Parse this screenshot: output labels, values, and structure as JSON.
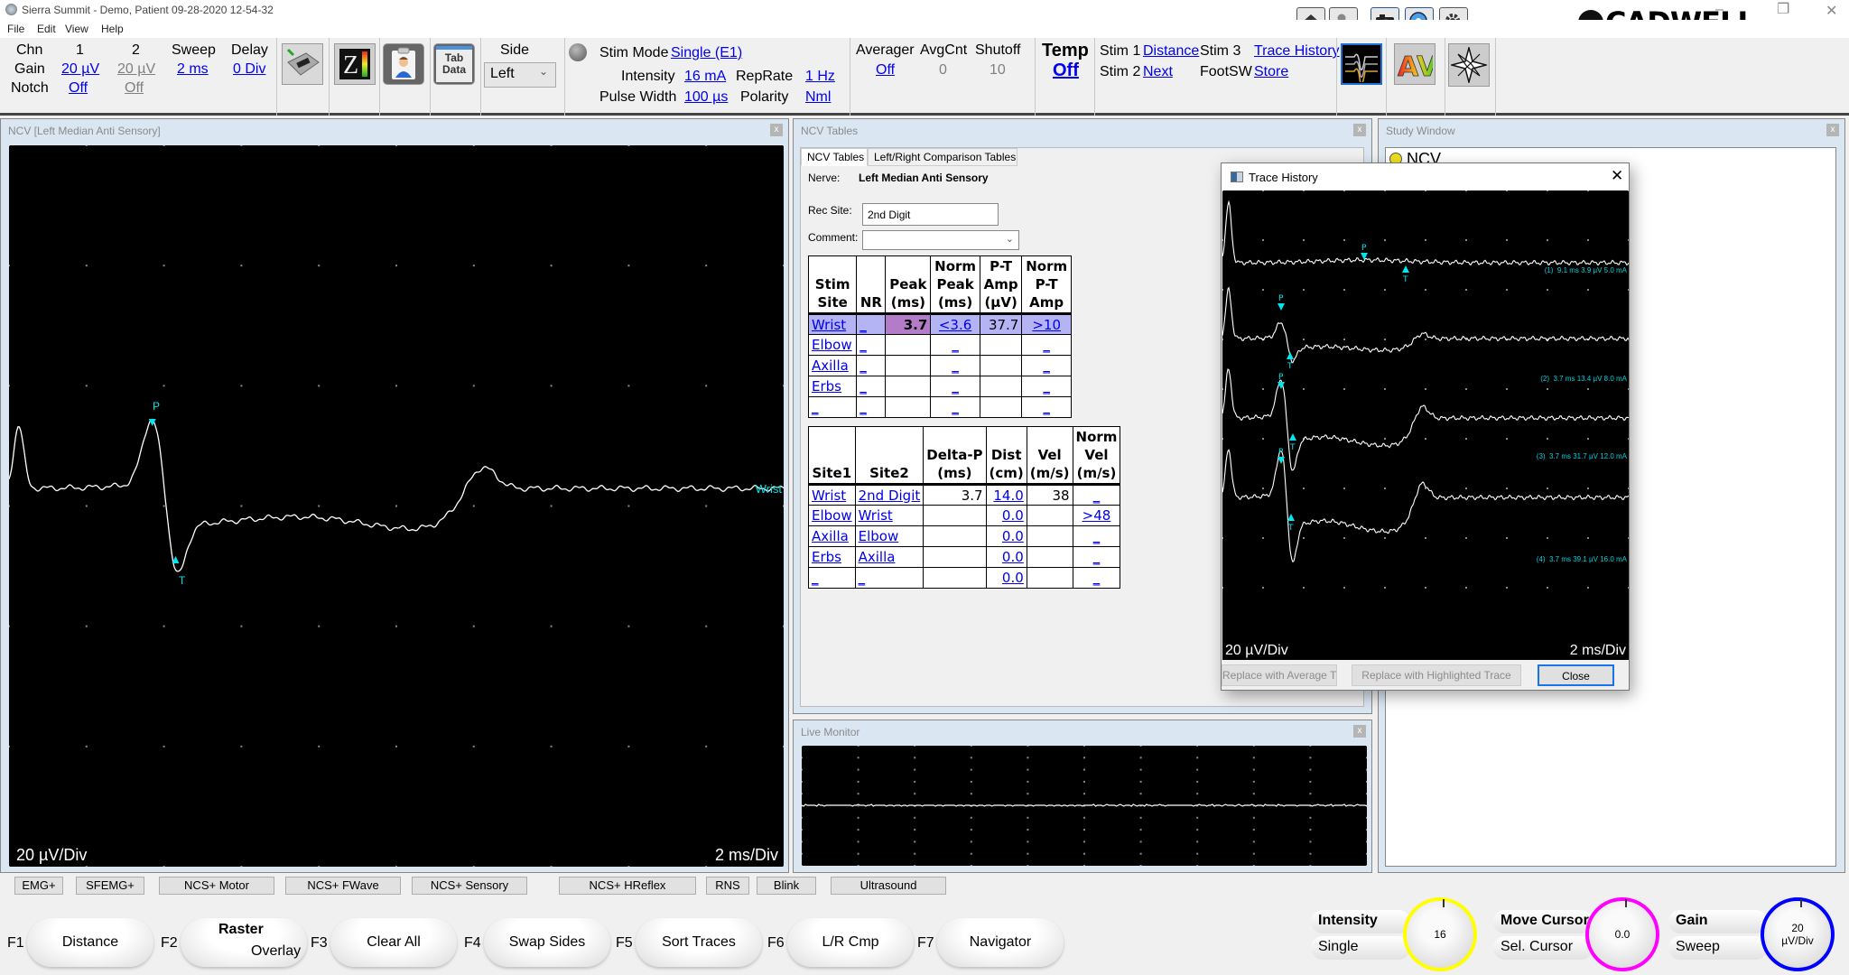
{
  "window": {
    "title": "Sierra Summit - Demo, Patient 09-28-2020 12-54-32",
    "logo": "CADWELL",
    "controls": {
      "minimize": "–",
      "restore": "❐",
      "close": "✕"
    }
  },
  "menu": [
    "File",
    "Edit",
    "View",
    "Help"
  ],
  "titlebar_icons": [
    "home-icon",
    "add-patient-icon",
    "camera-icon",
    "video-record-icon",
    "settings-icon"
  ],
  "toolbar": {
    "channel": {
      "chn_label": "Chn",
      "ch1": "1",
      "ch2": "2",
      "gain_label": "Gain",
      "gain1": "20 µV",
      "gain2": "20 µV",
      "notch_label": "Notch",
      "notch1": "Off",
      "notch2": "Off",
      "sweep_label": "Sweep",
      "sweep": "2 ms",
      "delay_label": "Delay",
      "delay": "0 Div"
    },
    "side": {
      "label": "Side",
      "value": "Left"
    },
    "stim": {
      "mode_label": "Stim Mode",
      "mode": "Single (E1)",
      "intensity_label": "Intensity",
      "intensity": "16 mA",
      "reprate_label": "RepRate",
      "reprate": "1 Hz",
      "pulse_label": "Pulse Width",
      "pulse": "100 µs",
      "polarity_label": "Polarity",
      "polarity": "Nml"
    },
    "averager": {
      "averager_label": "Averager",
      "averager": "Off",
      "avgcnt_label": "AvgCnt",
      "avgcnt": "0",
      "shutoff_label": "Shutoff",
      "shutoff": "10"
    },
    "temp": {
      "label": "Temp",
      "value": "Off"
    },
    "stim_keys": {
      "stim1_label": "Stim 1",
      "stim1": "Distance",
      "stim3_label": "Stim 3",
      "stim3": "Trace History",
      "stim2_label": "Stim 2",
      "stim2": "Next",
      "footsw_label": "FootSW",
      "footsw": "Store"
    },
    "tab_data": "Tab\nData"
  },
  "main_panel": {
    "title": "NCV [Left Median Anti Sensory]",
    "trace_label": "Wrist",
    "gain_readout": "20 µV/Div",
    "sweep_readout": "2 ms/Div",
    "markers": {
      "peak": "P",
      "trough": "T"
    }
  },
  "ncv_tables": {
    "panel_title": "NCV Tables",
    "tabs": [
      "NCV Tables",
      "Left/Right Comparison Tables"
    ],
    "nerve_label": "Nerve:",
    "nerve": "Left Median Anti Sensory",
    "rec_site_label": "Rec Site:",
    "rec_site": "2nd Digit",
    "comment_label": "Comment:",
    "comment": "",
    "latency_table": {
      "headers": [
        "Stim\nSite",
        "NR",
        "Peak\n(ms)",
        "Norm\nPeak\n(ms)",
        "P-T\nAmp\n(µV)",
        "Norm\nP-T\nAmp"
      ],
      "rows": [
        [
          "Wrist",
          "_",
          "3.7",
          "<3.6",
          "37.7",
          ">10"
        ],
        [
          "Elbow",
          "_",
          "",
          "_",
          "",
          "_"
        ],
        [
          "Axilla",
          "_",
          "",
          "_",
          "",
          "_"
        ],
        [
          "Erbs",
          "_",
          "",
          "_",
          "",
          "_"
        ],
        [
          "_",
          "_",
          "",
          "_",
          "",
          "_"
        ]
      ]
    },
    "velocity_table": {
      "headers": [
        "Site1",
        "Site2",
        "Delta-P\n(ms)",
        "Dist\n(cm)",
        "Vel\n(m/s)",
        "Norm\nVel\n(m/s)"
      ],
      "rows": [
        [
          "Wrist",
          "2nd Digit",
          "3.7",
          "14.0",
          "38",
          "_"
        ],
        [
          "Elbow",
          "Wrist",
          "",
          "0.0",
          "",
          ">48"
        ],
        [
          "Axilla",
          "Elbow",
          "",
          "0.0",
          "",
          "_"
        ],
        [
          "Erbs",
          "Axilla",
          "",
          "0.0",
          "",
          "_"
        ],
        [
          "_",
          "_",
          "",
          "0.0",
          "",
          "_"
        ]
      ]
    }
  },
  "live_monitor": {
    "title": "Live Monitor"
  },
  "study_window": {
    "title": "Study Window",
    "tree_root": "NCV"
  },
  "trace_history": {
    "title": "Trace History",
    "traces": [
      {
        "label": "(1)  9.1 ms 3.9 µV 5.0 mA",
        "peak_ms": 9.1,
        "amp_uv": 3.9,
        "stim_ma": 5.0
      },
      {
        "label": "(2)  3.7 ms 13.4 µV 8.0 mA",
        "peak_ms": 3.7,
        "amp_uv": 13.4,
        "stim_ma": 8.0
      },
      {
        "label": "(3)  3.7 ms 31.7 µV 12.0 mA",
        "peak_ms": 3.7,
        "amp_uv": 31.7,
        "stim_ma": 12.0
      },
      {
        "label": "(4)  3.7 ms 39.1 µV 16.0 mA",
        "peak_ms": 3.7,
        "amp_uv": 39.1,
        "stim_ma": 16.0
      }
    ],
    "gain_readout": "20 µV/Div",
    "sweep_readout": "2 ms/Div",
    "buttons": {
      "replace_average": "Replace with Average Trace",
      "replace_highlighted": "Replace with Highlighted Trace",
      "close": "Close"
    }
  },
  "mode_buttons": [
    "EMG+",
    "SFEMG+",
    "NCS+ Motor",
    "NCS+ FWave",
    "NCS+ Sensory",
    "NCS+ HReflex",
    "RNS",
    "Blink",
    "Ultrasound"
  ],
  "function_keys": [
    {
      "key": "F1",
      "label": "Distance"
    },
    {
      "key": "F2",
      "label_top": "Raster",
      "label": "Overlay"
    },
    {
      "key": "F3",
      "label": "Clear All"
    },
    {
      "key": "F4",
      "label": "Swap Sides"
    },
    {
      "key": "F5",
      "label": "Sort Traces"
    },
    {
      "key": "F6",
      "label": "L/R Cmp"
    },
    {
      "key": "F7",
      "label": "Navigator"
    }
  ],
  "knobs": [
    {
      "top": "Intensity",
      "bottom": "Single",
      "value": "16",
      "color": "#ffff00"
    },
    {
      "top": "Move Cursor",
      "bottom": "Sel. Cursor",
      "value": "0.0",
      "color": "#ff00ff"
    },
    {
      "top": "Gain",
      "bottom": "Sweep",
      "value": "20\nµV/Div",
      "color": "#0000ff"
    }
  ],
  "colors": {
    "marker": "#00e5ee",
    "link": "#0000ee",
    "selected_row": "#b4b4f4",
    "peak_cell": "#b47cc8",
    "panel_bg": "#dbe6f3"
  }
}
